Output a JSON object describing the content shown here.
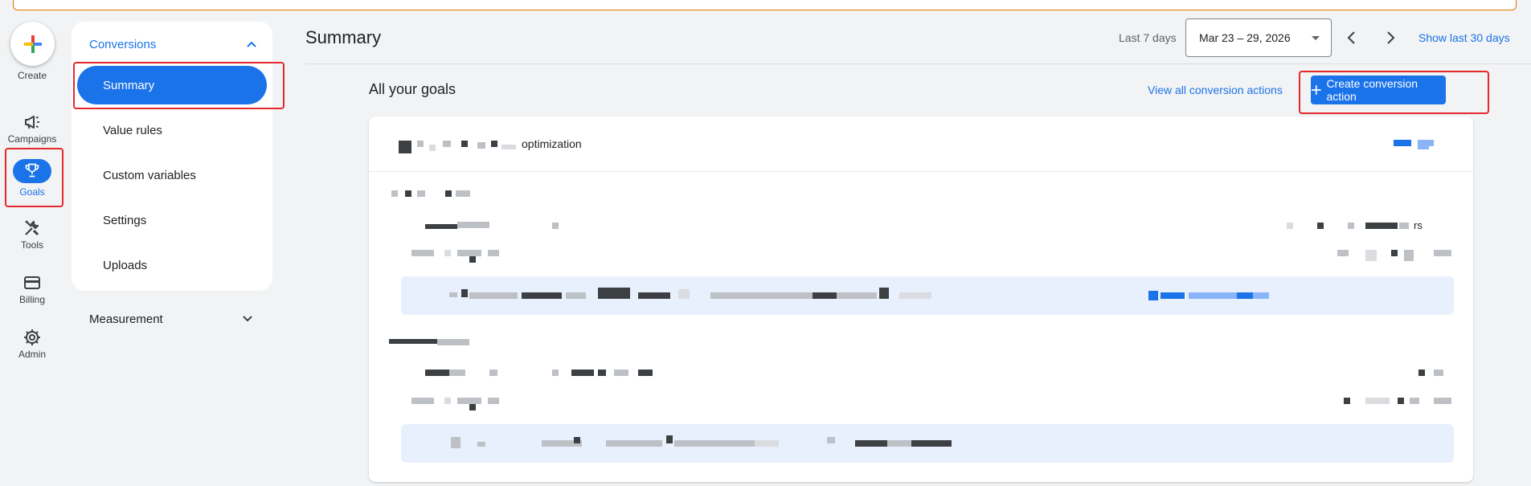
{
  "rail": {
    "create_label": "Create",
    "items": [
      {
        "label": "Campaigns",
        "icon": "megaphone-icon"
      },
      {
        "label": "Goals",
        "icon": "trophy-icon"
      },
      {
        "label": "Tools",
        "icon": "tools-icon"
      },
      {
        "label": "Billing",
        "icon": "credit-card-icon"
      },
      {
        "label": "Admin",
        "icon": "gear-icon"
      }
    ]
  },
  "nav": {
    "section_label": "Conversions",
    "items": [
      {
        "label": "Summary",
        "active": true
      },
      {
        "label": "Value rules",
        "active": false
      },
      {
        "label": "Custom variables",
        "active": false
      },
      {
        "label": "Settings",
        "active": false
      },
      {
        "label": "Uploads",
        "active": false
      }
    ],
    "measurement_label": "Measurement"
  },
  "header": {
    "title": "Summary",
    "range_label": "Last 7 days",
    "date_value": "Mar 23 – 29, 2026",
    "show_30_label": "Show last 30 days"
  },
  "goals": {
    "heading": "All your goals",
    "view_all_label": "View all conversion actions",
    "create_label": "Create conversion action",
    "card_title_fragment": "optimization",
    "row_tail_fragment": "rs"
  },
  "colors": {
    "accent": "#1a73e8",
    "highlight": "#e5282c",
    "band": "#e8f0fe"
  }
}
